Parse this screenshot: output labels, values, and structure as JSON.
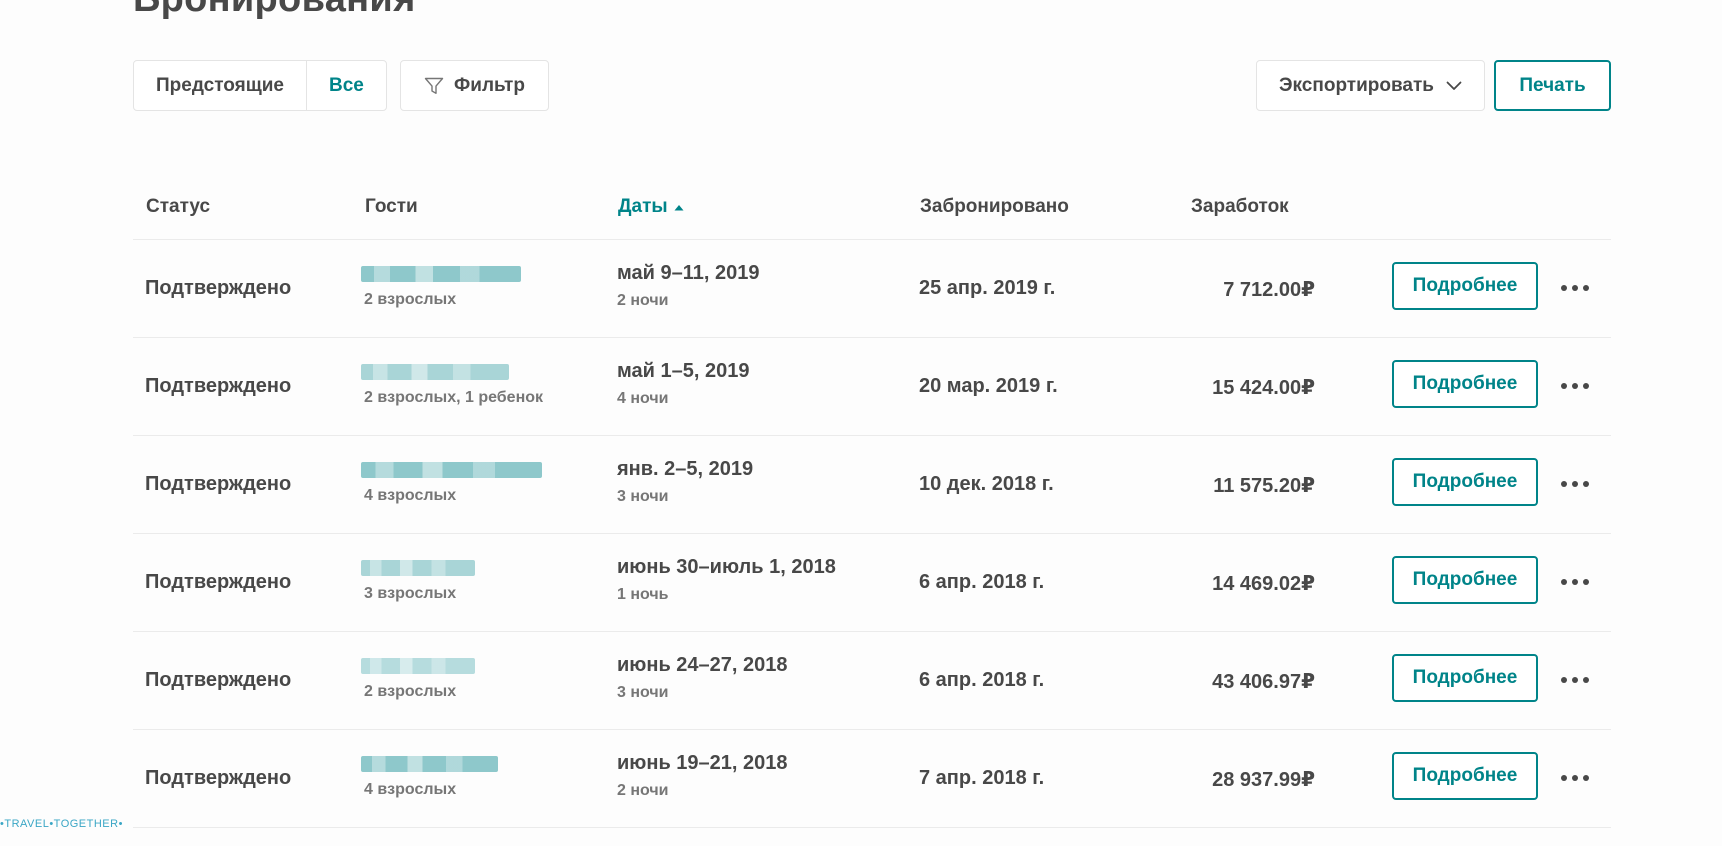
{
  "page": {
    "title": "Бронирования"
  },
  "toolbar": {
    "tab_upcoming": "Предстоящие",
    "tab_all": "Все",
    "filter_label": "Фильтр",
    "export_label": "Экспортировать",
    "print_label": "Печать"
  },
  "table": {
    "headers": {
      "status": "Статус",
      "guests": "Гости",
      "dates": "Даты",
      "booked": "Забронировано",
      "earnings": "Заработок"
    },
    "details_label": "Подробнее",
    "rows": [
      {
        "status": "Подтверждено",
        "guests": "2 взрослых",
        "dates": "май 9–11, 2019",
        "nights": "2 ночи",
        "booked": "25 апр. 2019 г.",
        "earnings": "7 712.00₽"
      },
      {
        "status": "Подтверждено",
        "guests": "2 взрослых, 1 ребенок",
        "dates": "май 1–5, 2019",
        "nights": "4 ночи",
        "booked": "20 мар. 2019 г.",
        "earnings": "15 424.00₽"
      },
      {
        "status": "Подтверждено",
        "guests": "4 взрослых",
        "dates": "янв. 2–5, 2019",
        "nights": "3 ночи",
        "booked": "10 дек. 2018 г.",
        "earnings": "11 575.20₽"
      },
      {
        "status": "Подтверждено",
        "guests": "3 взрослых",
        "dates": "июнь 30–июль 1, 2018",
        "nights": "1 ночь",
        "booked": "6 апр. 2018 г.",
        "earnings": "14 469.02₽"
      },
      {
        "status": "Подтверждено",
        "guests": "2 взрослых",
        "dates": "июнь 24–27, 2018",
        "nights": "3 ночи",
        "booked": "6 апр. 2018 г.",
        "earnings": "43 406.97₽"
      },
      {
        "status": "Подтверждено",
        "guests": "4 взрослых",
        "dates": "июнь 19–21, 2018",
        "nights": "2 ночи",
        "booked": "7 апр. 2018 г.",
        "earnings": "28 937.99₽"
      }
    ]
  },
  "colors": {
    "accent": "#008489",
    "text": "#484848",
    "muted": "#767676",
    "redacted": "#8ec8cb"
  },
  "watermark": "•TRAVEL•TOGETHER•"
}
